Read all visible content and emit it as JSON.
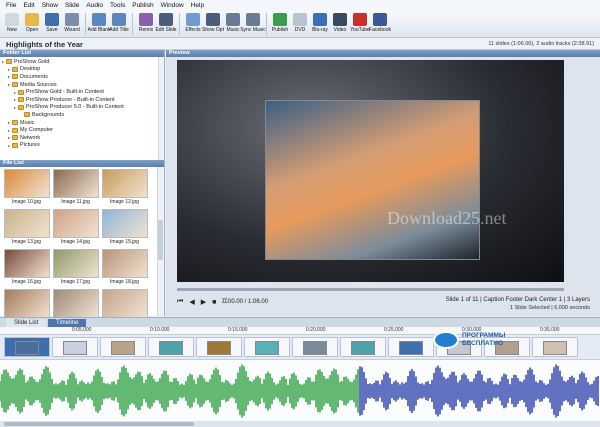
{
  "menu": [
    "File",
    "Edit",
    "Show",
    "Slide",
    "Audio",
    "Tools",
    "Publish",
    "Window",
    "Help"
  ],
  "toolbar": [
    {
      "label": "New",
      "icon": "new-icon",
      "color": "#cfd8e4"
    },
    {
      "label": "Open",
      "icon": "open-folder-icon",
      "color": "#e6b94a"
    },
    {
      "label": "Save",
      "icon": "save-icon",
      "color": "#3f6fae"
    },
    {
      "label": "Wizard",
      "icon": "wizard-icon",
      "color": "#7a8fa8"
    },
    {
      "label": "Add Blank",
      "icon": "add-blank-icon",
      "color": "#5c86bd"
    },
    {
      "label": "Add Title",
      "icon": "add-title-icon",
      "color": "#5c86bd"
    },
    {
      "label": "Remix",
      "icon": "remix-icon",
      "color": "#8b5fb0"
    },
    {
      "label": "Edit Slide",
      "icon": "edit-slide-icon",
      "color": "#4a5e78"
    },
    {
      "label": "Effects",
      "icon": "effects-icon",
      "color": "#6f9bd1"
    },
    {
      "label": "Show Opt",
      "icon": "show-options-icon",
      "color": "#4a5e78"
    },
    {
      "label": "Music",
      "icon": "music-icon",
      "color": "#6a7b93"
    },
    {
      "label": "Sync Music",
      "icon": "sync-music-icon",
      "color": "#6a7b93"
    },
    {
      "label": "Publish",
      "icon": "publish-icon",
      "color": "#3d9a4f"
    },
    {
      "label": "DVD",
      "icon": "dvd-icon",
      "color": "#b9c2cf"
    },
    {
      "label": "Blu-ray",
      "icon": "bluray-icon",
      "color": "#3a6fb7"
    },
    {
      "label": "Video",
      "icon": "video-icon",
      "color": "#3b4a63"
    },
    {
      "label": "YouTube",
      "icon": "youtube-icon",
      "color": "#c9302c"
    },
    {
      "label": "Facebook",
      "icon": "facebook-icon",
      "color": "#3b5998"
    }
  ],
  "project": {
    "title": "Highlights of the Year",
    "info": "11 slides (1:06.00), 2 audio tracks (2:38.91)"
  },
  "folder_list": {
    "header": "Folder List",
    "items": [
      {
        "label": "ProShow Gold",
        "indent": 0
      },
      {
        "label": "Desktop",
        "indent": 1
      },
      {
        "label": "Documents",
        "indent": 1
      },
      {
        "label": "Media Sources",
        "indent": 1
      },
      {
        "label": "ProShow Gold - Built-in Content",
        "indent": 2
      },
      {
        "label": "ProShow Producer - Built-in Content",
        "indent": 2
      },
      {
        "label": "ProShow Producer 5.0 - Built-in Content",
        "indent": 2
      },
      {
        "label": "Backgrounds",
        "indent": 3
      },
      {
        "label": "Music",
        "indent": 1
      },
      {
        "label": "My Computer",
        "indent": 1
      },
      {
        "label": "Network",
        "indent": 1
      },
      {
        "label": "Pictures",
        "indent": 1
      }
    ]
  },
  "file_list": {
    "header": "File List",
    "items": [
      {
        "label": "Image 10.jpg",
        "color": "#d98a3c"
      },
      {
        "label": "Image 11.jpg",
        "color": "#8a6a52"
      },
      {
        "label": "Image 12.jpg",
        "color": "#c79c5a"
      },
      {
        "label": "Image 13.jpg",
        "color": "#c9b48a"
      },
      {
        "label": "Image 14.jpg",
        "color": "#d0a186"
      },
      {
        "label": "Image 15.jpg",
        "color": "#8fb4d6"
      },
      {
        "label": "Image 16.jpg",
        "color": "#7a4a3a"
      },
      {
        "label": "Image 17.jpg",
        "color": "#8e9a6a"
      },
      {
        "label": "Image 18.jpg",
        "color": "#b89478"
      },
      {
        "label": "",
        "color": "#a47a5a"
      },
      {
        "label": "",
        "color": "#9c8a74"
      },
      {
        "label": "",
        "color": "#c4a48a"
      }
    ]
  },
  "preview": {
    "header": "Preview",
    "watermark": "Download25.net",
    "timecode": "0:00.00 / 1:06.00",
    "slide_info": "Slide 1 of 11  |  Caption Footer Dark Center 1  |  3 Layers",
    "selection": "1 Slide Selected  |  6.000 seconds"
  },
  "tabs": [
    "Slide List",
    "Timeline"
  ],
  "ruler": [
    "0:05.000",
    "0:10.000",
    "0:15.000",
    "0:20.000",
    "0:25.000",
    "0:30.000",
    "0:35.000"
  ],
  "slides": [
    {
      "color": "#4a6f9c"
    },
    {
      "color": "#c8d2de"
    },
    {
      "color": "#b8a288"
    },
    {
      "color": "#4fa3a8"
    },
    {
      "color": "#9c7a3a"
    },
    {
      "color": "#5ab0b8"
    },
    {
      "color": "#7a8a9a"
    },
    {
      "color": "#4fa3a8"
    },
    {
      "color": "#3f6fae"
    },
    {
      "color": "#c4c8d0"
    },
    {
      "color": "#b0a090"
    },
    {
      "color": "#d0c0b0"
    }
  ],
  "logo": {
    "line1": "ПРОГРАММЫ",
    "line2": "БЕСПЛАТНО"
  },
  "colors": {
    "audio_green": "#3fa84f",
    "audio_blue": "#3b4fb0"
  }
}
